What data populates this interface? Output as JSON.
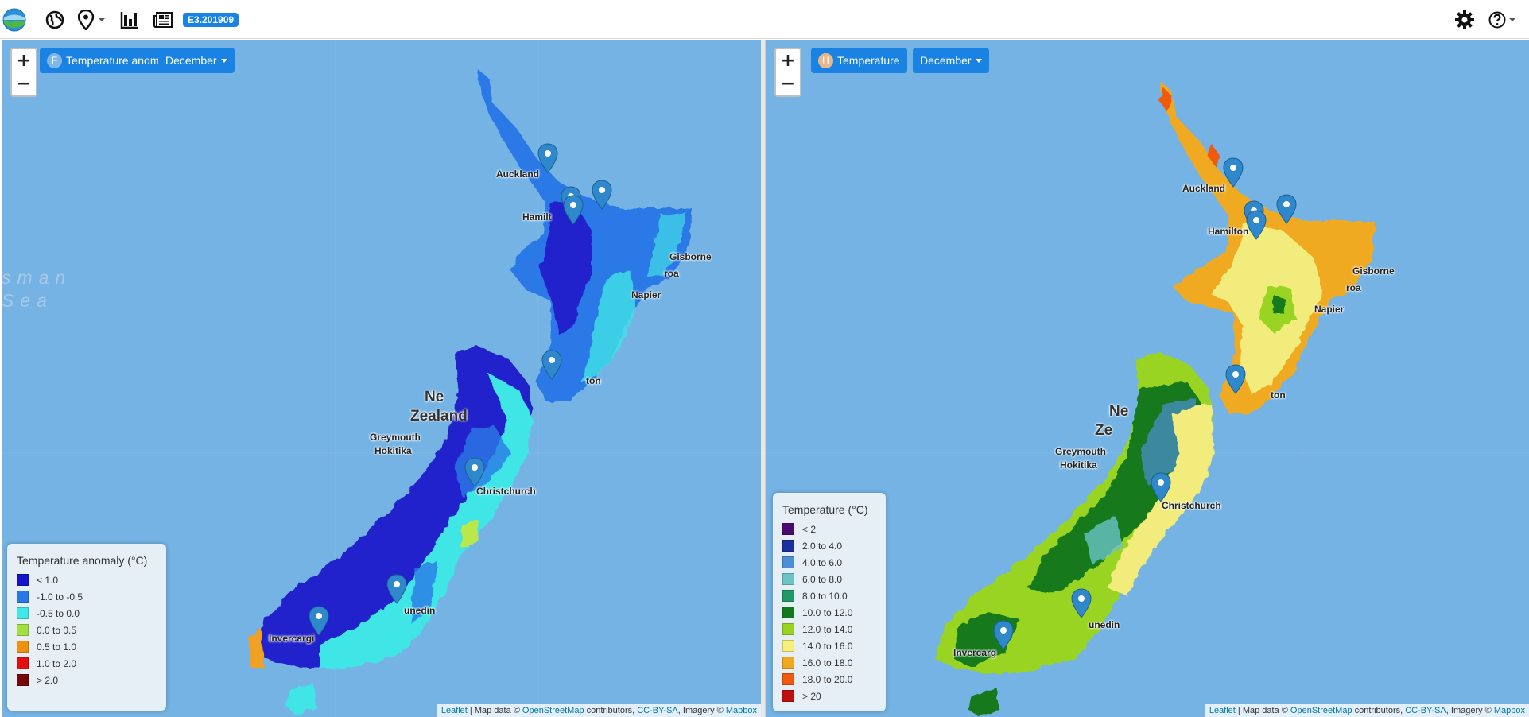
{
  "app": {
    "version": "E3.201909"
  },
  "left_panel": {
    "layer_letter": "F",
    "layer_letter_color": "#7fb7e6",
    "layer_label": "Temperature anomaly",
    "month_label": "December",
    "legend": {
      "title": "Temperature anomaly (°C)",
      "items": [
        {
          "label": "< 1.0",
          "color": "#1414c8"
        },
        {
          "label": "-1.0 to -0.5",
          "color": "#2878e8"
        },
        {
          "label": "-0.5 to 0.0",
          "color": "#3fe8e8"
        },
        {
          "label": "0.0 to 0.5",
          "color": "#a0e040"
        },
        {
          "label": "0.5 to 1.0",
          "color": "#f09010"
        },
        {
          "label": "1.0 to 2.0",
          "color": "#e01010"
        },
        {
          "label": "> 2.0",
          "color": "#780808"
        }
      ]
    },
    "cities": {
      "auckland": "Auckland",
      "hamilton": "Hamilt",
      "gisborne": "Gisborne",
      "wairoa": "roa",
      "napier": "Napier",
      "wellington": "ton",
      "nz1": "Ne",
      "nz2": "Zealand",
      "greymouth": "Greymouth",
      "hokitika": "Hokitika",
      "christchurch": "Christchurch",
      "dunedin": "unedin",
      "invercargill": "Invercargi"
    },
    "sea": {
      "line1": "sman",
      "line2": "Sea"
    }
  },
  "right_panel": {
    "layer_letter": "H",
    "layer_letter_color": "#e7b98a",
    "layer_label": "Temperature",
    "month_label": "December",
    "legend": {
      "title": "Temperature (°C)",
      "items": [
        {
          "label": "< 2",
          "color": "#4b0a6e"
        },
        {
          "label": "2.0 to 4.0",
          "color": "#1a2fa0"
        },
        {
          "label": "4.0 to 6.0",
          "color": "#4c8fd6"
        },
        {
          "label": "6.0 to 8.0",
          "color": "#6cc4c4"
        },
        {
          "label": "8.0 to 10.0",
          "color": "#1f9a64"
        },
        {
          "label": "10.0 to 12.0",
          "color": "#127a1e"
        },
        {
          "label": "12.0 to 14.0",
          "color": "#9ad420"
        },
        {
          "label": "14.0 to 16.0",
          "color": "#f5f07a"
        },
        {
          "label": "16.0 to 18.0",
          "color": "#f0a820"
        },
        {
          "label": "18.0 to 20.0",
          "color": "#f05a10"
        },
        {
          "label": "> 20",
          "color": "#c00e0e"
        }
      ]
    },
    "cities": {
      "auckland": "Auckland",
      "hamilton": "Hamilton",
      "gisborne": "Gisborne",
      "wairoa": "roa",
      "napier": "Napier",
      "wellington": "ton",
      "nz1": "Ne",
      "nz2": "Ze",
      "greymouth": "Greymouth",
      "hokitika": "Hokitika",
      "christchurch": "Christchurch",
      "dunedin": "unedin",
      "invercargill": "Invercarg"
    }
  },
  "attribution": {
    "leaflet": "Leaflet",
    "sep": " | Map data © ",
    "osm": "OpenStreetMap",
    "contrib": " contributors, ",
    "license": "CC-BY-SA",
    "imagery": ", Imagery © ",
    "mapbox": "Mapbox"
  },
  "colors": {
    "primary": "#1a82e2",
    "sea": "#74b3e3",
    "marker": "#2f88cc"
  },
  "icons": [
    "logo",
    "globe-icon",
    "location-pin-icon",
    "bar-chart-icon",
    "newspaper-icon",
    "gear-icon",
    "help-icon"
  ]
}
